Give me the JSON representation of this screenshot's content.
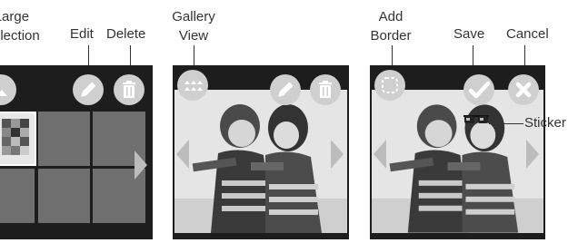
{
  "labels": {
    "large_selection": "Large\nSelection",
    "edit": "Edit",
    "delete": "Delete",
    "gallery_view": "Gallery\nView",
    "add_border": "Add\nBorder",
    "save": "Save",
    "cancel": "Cancel",
    "sticker": "Sticker"
  },
  "icons": {
    "edit": "pencil-icon",
    "delete": "trash-icon",
    "gallery_view": "gallery-icon",
    "add_border": "dotted-square-icon",
    "save": "checkmark-icon",
    "cancel": "x-icon",
    "sticker": "sunglasses-icon",
    "prev": "left-arrow-icon",
    "next": "right-arrow-icon"
  },
  "colors": {
    "screen_bg": "#1d1d1d",
    "cell": "#6f6f6f",
    "icon_circle": "#cfcfcf",
    "icon_glyph": "#ffffff"
  }
}
